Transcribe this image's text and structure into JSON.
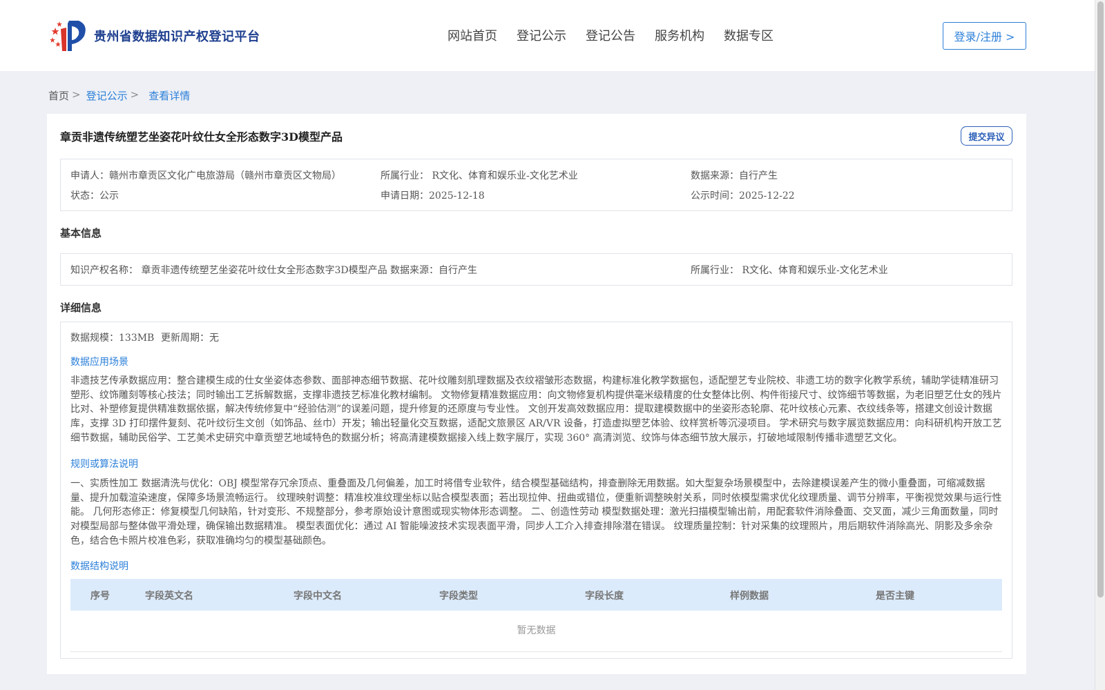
{
  "header": {
    "logo_text": "贵州省数据知识产权登记平台",
    "nav": [
      "网站首页",
      "登记公示",
      "登记公告",
      "服务机构",
      "数据专区"
    ],
    "login_label": "登录/注册 >"
  },
  "breadcrumb": {
    "home": "首页",
    "section": "登记公示",
    "current": "查看详情",
    "separator": ">"
  },
  "product": {
    "title": "章贡非遗传统塑艺坐姿花叶纹仕女全形态数字3D模型产品",
    "objection_label": "提交异议"
  },
  "summary": {
    "applicant": "申请人：赣州市章贡区文化广电旅游局（赣州市章贡区文物局）",
    "industry": "所属行业：  R文化、体育和娱乐业-文化艺术业",
    "source": "数据来源：自行产生",
    "status": "状态：公示",
    "apply_date": "申请日期：2025-12-18",
    "publish_date": "公示时间：2025-12-22"
  },
  "basic": {
    "section_title": "基本信息",
    "ip_name": "知识产权名称：  章贡非遗传统塑艺坐姿花叶纹仕女全形态数字3D模型产品 数据来源：自行产生",
    "industry": "所属行业：  R文化、体育和娱乐业-文化艺术业"
  },
  "detail": {
    "section_title": "详细信息",
    "scale": "数据规模：133MB",
    "cycle": "更新周期：无",
    "scenario_title": "数据应用场景",
    "scenario_text": "非遗技艺传承数据应用：整合建模生成的仕女坐姿体态参数、面部神态细节数据、花叶纹雕刻肌理数据及衣纹褶皱形态数据，构建标准化教学数据包，适配塑艺专业院校、非遗工坊的数字化教学系统，辅助学徒精准研习塑形、纹饰雕刻等核心技法；同时输出工艺拆解数据，支撑非遗技艺标准化教材编制。 文物修复精准数据应用：向文物修复机构提供毫米级精度的仕女整体比例、构件衔接尺寸、纹饰细节等数据，为老旧塑艺仕女的残片比对、补塑修复提供精准数据依据，解决传统修复中“经验估测”的误差问题，提升修复的还原度与专业性。 文创开发高效数据应用：提取建模数据中的坐姿形态轮廓、花叶纹核心元素、衣纹线条等，搭建文创设计数据库，支撑 3D 打印摆件复刻、花叶纹衍生文创（如饰品、丝巾）开发；输出轻量化交互数据，适配文旅景区 AR/VR 设备，打造虚拟塑艺体验、纹样赏析等沉浸项目。 学术研究与数字展览数据应用：向科研机构开放工艺细节数据，辅助民俗学、工艺美术史研究中章贡塑艺地域特色的数据分析；将高清建模数据接入线上数字展厅，实现 360° 高清浏览、纹饰与体态细节放大展示，打破地域限制传播非遗塑艺文化。",
    "rules_title": "规则或算法说明",
    "rules_text": "一、实质性加工 数据清洗与优化：OBJ 模型常存冗余顶点、重叠面及几何偏差，加工时将借专业软件，结合模型基础结构，排查删除无用数据。如大型复杂场景模型中，去除建模误差产生的微小重叠面，可缩减数据量、提升加载渲染速度，保障多场景流畅运行。 纹理映射调整：精准校准纹理坐标以贴合模型表面；若出现拉伸、扭曲或错位，便重新调整映射关系，同时依模型需求优化纹理质量、调节分辨率，平衡视觉效果与运行性能。 几何形态修正：修复模型几何缺陷，针对变形、不规整部分，参考原始设计意图或现实物体形态调整。 二、创造性劳动 模型数据处理：激光扫描模型输出前，用配套软件消除叠面、交叉面，减少三角面数量，同时对模型局部与整体做平滑处理，确保输出数据精准。 模型表面优化：通过 AI 智能噪波技术实现表面平滑，同步人工介入排查排除潜在错误。 纹理质量控制：针对采集的纹理照片，用后期软件消除高光、阴影及多余杂色，结合色卡照片校准色彩，获取准确均匀的模型基础颜色。",
    "structure_title": "数据结构说明",
    "table_headers": [
      "序号",
      "字段英文名",
      "字段中文名",
      "字段类型",
      "字段长度",
      "样例数据",
      "是否主键"
    ],
    "empty_text": "暂无数据"
  },
  "colors": {
    "accent": "#2b7fd9",
    "logo_text": "#1e3f8f",
    "table_header_bg": "#dcebfb",
    "page_bg": "#eef0f5"
  }
}
